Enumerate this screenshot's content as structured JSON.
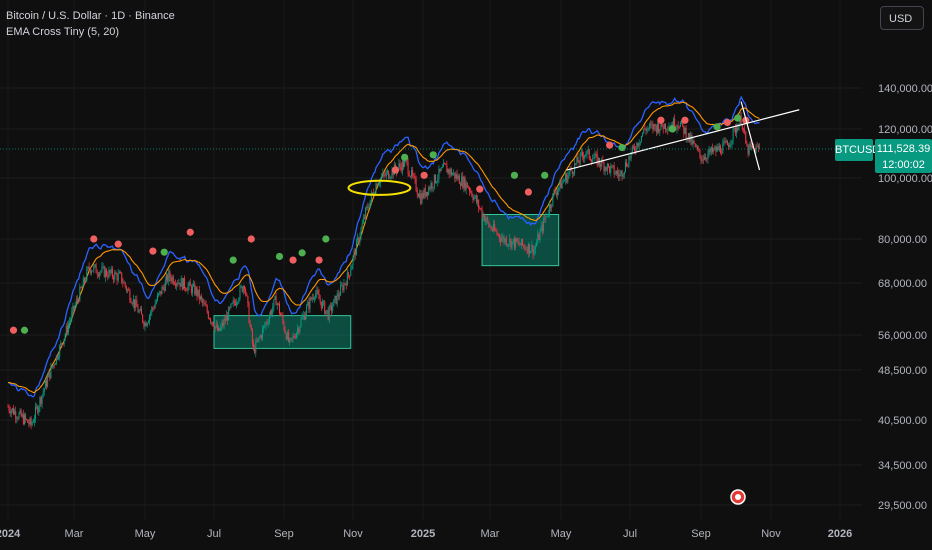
{
  "header": {
    "title": "Bitcoin / U.S. Dollar · 1D · Binance",
    "indicator": "EMA Cross Tiny (5, 20)"
  },
  "currency_button": "USD",
  "last_price": {
    "symbol": "BTCUSD",
    "price": "111,528.39",
    "countdown": "12:00:02"
  },
  "colors": {
    "background": "#0f0f0f",
    "up": "#089981",
    "down": "#f23645",
    "ema_fast": "#2962ff",
    "ema_slow": "#ff9800",
    "box": "#089981",
    "ellipse": "#f5e000",
    "trendline": "#ffffff"
  },
  "chart_data": {
    "type": "candlestick",
    "symbol": "BTCUSD",
    "interval": "1D",
    "y_scale": "log",
    "x_tick_labels": [
      "2024",
      "Mar",
      "May",
      "Jul",
      "Sep",
      "Nov",
      "2025",
      "Mar",
      "May",
      "Jul",
      "Sep",
      "Nov",
      "2026"
    ],
    "y_tick_labels": [
      "140,000.00",
      "120,000.00",
      "100,000.00",
      "80,000.00",
      "68,000.00",
      "56,000.00",
      "48,500.00",
      "40,500.00",
      "34,500.00",
      "29,500.00"
    ],
    "ylim": [
      28500,
      165000
    ],
    "series": [
      {
        "name": "BTCUSD",
        "type": "candles",
        "approx_close_path": [
          [
            "2024-01-01",
            42500
          ],
          [
            "2024-01-22",
            39800
          ],
          [
            "2024-02-15",
            51800
          ],
          [
            "2024-03-14",
            72000
          ],
          [
            "2024-04-10",
            69500
          ],
          [
            "2024-05-01",
            58500
          ],
          [
            "2024-05-22",
            69800
          ],
          [
            "2024-06-15",
            66000
          ],
          [
            "2024-07-05",
            56500
          ],
          [
            "2024-07-28",
            68000
          ],
          [
            "2024-08-05",
            52500
          ],
          [
            "2024-08-25",
            64000
          ],
          [
            "2024-09-06",
            53800
          ],
          [
            "2024-09-28",
            65800
          ],
          [
            "2024-10-10",
            60500
          ],
          [
            "2024-10-28",
            70000
          ],
          [
            "2024-11-12",
            88000
          ],
          [
            "2024-11-22",
            99000
          ],
          [
            "2024-12-17",
            106000
          ],
          [
            "2024-12-30",
            93000
          ],
          [
            "2025-01-20",
            104000
          ],
          [
            "2025-02-10",
            97000
          ],
          [
            "2025-02-28",
            84000
          ],
          [
            "2025-03-12",
            80000
          ],
          [
            "2025-04-08",
            77000
          ],
          [
            "2025-04-25",
            94500
          ],
          [
            "2025-05-22",
            110000
          ],
          [
            "2025-06-22",
            101000
          ],
          [
            "2025-07-14",
            120000
          ],
          [
            "2025-08-13",
            123000
          ],
          [
            "2025-09-01",
            108000
          ],
          [
            "2025-09-24",
            113000
          ],
          [
            "2025-10-06",
            125000
          ],
          [
            "2025-10-11",
            111000
          ],
          [
            "2025-10-22",
            111528.39
          ]
        ]
      },
      {
        "name": "EMA 5",
        "type": "line"
      },
      {
        "name": "EMA 20",
        "type": "line"
      }
    ],
    "cross_markers": [
      {
        "x": "2024-01-06",
        "y": 57000,
        "dir": "down"
      },
      {
        "x": "2024-01-16",
        "y": 57000,
        "dir": "up"
      },
      {
        "x": "2024-03-18",
        "y": 80000,
        "dir": "down"
      },
      {
        "x": "2024-04-08",
        "y": 78500,
        "dir": "down"
      },
      {
        "x": "2024-05-08",
        "y": 76500,
        "dir": "down"
      },
      {
        "x": "2024-05-18",
        "y": 76200,
        "dir": "up"
      },
      {
        "x": "2024-06-10",
        "y": 82000,
        "dir": "down"
      },
      {
        "x": "2024-07-18",
        "y": 74000,
        "dir": "up"
      },
      {
        "x": "2024-08-03",
        "y": 80000,
        "dir": "down"
      },
      {
        "x": "2024-08-28",
        "y": 75000,
        "dir": "up"
      },
      {
        "x": "2024-09-09",
        "y": 74000,
        "dir": "down"
      },
      {
        "x": "2024-09-17",
        "y": 76000,
        "dir": "up"
      },
      {
        "x": "2024-10-02",
        "y": 74000,
        "dir": "down"
      },
      {
        "x": "2024-10-08",
        "y": 80000,
        "dir": "up"
      },
      {
        "x": "2024-12-08",
        "y": 103000,
        "dir": "down"
      },
      {
        "x": "2024-12-16",
        "y": 108000,
        "dir": "up"
      },
      {
        "x": "2025-01-02",
        "y": 101000,
        "dir": "down"
      },
      {
        "x": "2025-01-10",
        "y": 109000,
        "dir": "up"
      },
      {
        "x": "2025-02-20",
        "y": 96000,
        "dir": "down"
      },
      {
        "x": "2025-03-22",
        "y": 101000,
        "dir": "up"
      },
      {
        "x": "2025-04-03",
        "y": 95000,
        "dir": "down"
      },
      {
        "x": "2025-04-17",
        "y": 101000,
        "dir": "up"
      },
      {
        "x": "2025-06-13",
        "y": 113000,
        "dir": "down"
      },
      {
        "x": "2025-06-24",
        "y": 112000,
        "dir": "up"
      },
      {
        "x": "2025-07-28",
        "y": 124000,
        "dir": "down"
      },
      {
        "x": "2025-08-07",
        "y": 120000,
        "dir": "up"
      },
      {
        "x": "2025-08-18",
        "y": 124000,
        "dir": "down"
      },
      {
        "x": "2025-09-15",
        "y": 121000,
        "dir": "up"
      },
      {
        "x": "2025-09-24",
        "y": 123000,
        "dir": "down"
      },
      {
        "x": "2025-10-03",
        "y": 125000,
        "dir": "up"
      },
      {
        "x": "2025-10-10",
        "y": 124000,
        "dir": "down"
      }
    ],
    "drawings": [
      {
        "kind": "rectangle",
        "color": "#089981",
        "x": [
          "2024-07-01",
          "2024-10-30"
        ],
        "y": [
          53000,
          60200
        ]
      },
      {
        "kind": "rectangle",
        "color": "#089981",
        "x": [
          "2025-02-22",
          "2025-04-29"
        ],
        "y": [
          72500,
          87500
        ]
      },
      {
        "kind": "ellipse",
        "color": "#f5e000",
        "x": [
          "2024-10-28",
          "2024-12-21"
        ],
        "y": [
          94000,
          99000
        ]
      },
      {
        "kind": "trendline",
        "color": "#ffffff",
        "x": [
          "2025-05-06",
          "2025-11-26"
        ],
        "y": [
          103000,
          129000
        ]
      },
      {
        "kind": "line",
        "color": "#ffffff",
        "x": [
          "2025-10-06",
          "2025-10-22"
        ],
        "y": [
          133000,
          103000
        ]
      }
    ],
    "grid": true
  }
}
